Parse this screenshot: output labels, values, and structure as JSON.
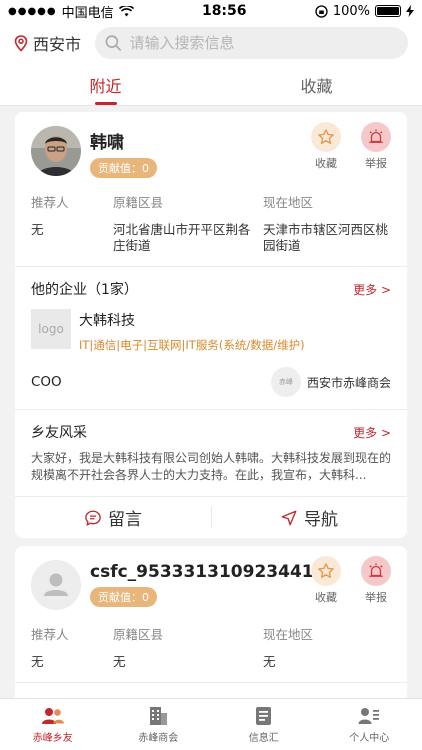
{
  "status_bar": {
    "carrier": "中国电信",
    "time": "18:56",
    "battery": "100%"
  },
  "top": {
    "city": "西安市",
    "search_placeholder": "请输入搜索信息"
  },
  "tabs": [
    {
      "label": "附近",
      "active": true
    },
    {
      "label": "收藏",
      "active": false
    }
  ],
  "cards": [
    {
      "name": "韩啸",
      "contribution": "贡献值：0",
      "fav_label": "收藏",
      "report_label": "举报",
      "info_labels": [
        "推荐人",
        "原籍区县",
        "现在地区"
      ],
      "info_values": [
        "无",
        "河北省唐山市开平区荆各庄街道",
        "天津市市辖区河西区桃园街道"
      ],
      "enterprise_title": "他的企业（1家）",
      "more": "更多 >",
      "company": {
        "logo_text": "logo",
        "name": "大韩科技",
        "tags": "IT|通信|电子|互联网|IT服务(系统/数据/维护)"
      },
      "role": "COO",
      "chamber_logo_text": "赤峰",
      "chamber": "西安市赤峰商会",
      "moments_title": "乡友风采",
      "moments_more": "更多 >",
      "moments_text": "大家好，我是大韩科技有限公司创始人韩啸。大韩科技发展到现在的规模离不开社会各界人士的大力支持。在此，我宣布，大韩科...",
      "message_label": "留言",
      "navigate_label": "导航"
    },
    {
      "name": "csfc_953331310923441",
      "contribution": "贡献值：0",
      "fav_label": "收藏",
      "report_label": "举报",
      "info_labels": [
        "推荐人",
        "原籍区县",
        "现在地区"
      ],
      "info_values": [
        "无",
        "无",
        "无"
      ]
    }
  ],
  "tabbar": [
    {
      "label": "赤峰乡友",
      "icon": "people-icon",
      "active": true
    },
    {
      "label": "赤峰商会",
      "icon": "building-icon",
      "active": false
    },
    {
      "label": "信息汇",
      "icon": "document-icon",
      "active": false
    },
    {
      "label": "个人中心",
      "icon": "profile-icon",
      "active": false
    }
  ],
  "colors": {
    "accent": "#c2272d",
    "contribution_badge": "#e8b57a",
    "tag_text": "#d98a2b"
  }
}
